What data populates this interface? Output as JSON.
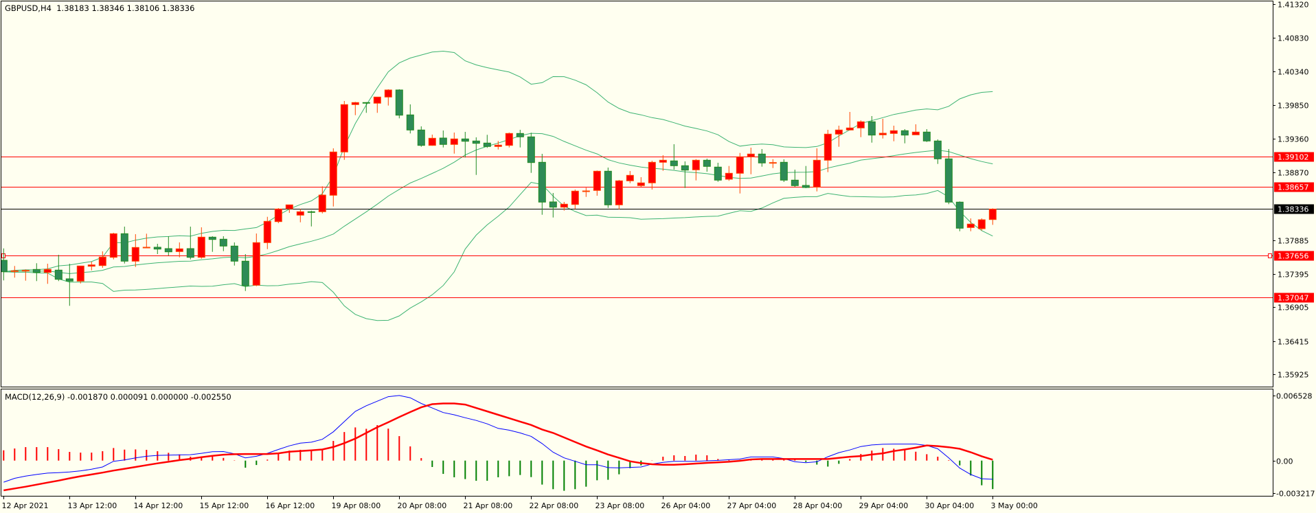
{
  "header": {
    "text": "GBPUSD,H4  1.38183 1.38346 1.38106 1.38336"
  },
  "macd_header": {
    "text": "MACD(12,26,9) -0.001870 0.000091 0.000000 -0.002550"
  },
  "colors": {
    "background": "#fffff0",
    "bull_body": "#ff0000",
    "bull_border": "#ff4500",
    "bear_body": "#2e8b57",
    "bear_border": "#228b22",
    "bands": "#3cb371",
    "macd_line": "#0000ff",
    "signal_line": "#ff0000",
    "hist_pos": "#ff0000",
    "hist_neg": "#008000"
  },
  "price_axis": [
    "1.41320",
    "1.40830",
    "1.40340",
    "1.39850",
    "1.39360",
    "1.38870",
    "1.37885",
    "1.37395",
    "1.36905",
    "1.36415",
    "1.35925"
  ],
  "macd_axis": [
    "0.006528",
    "0.00",
    "-0.003217"
  ],
  "time_axis": [
    "12 Apr 2021",
    "13 Apr 12:00",
    "14 Apr 12:00",
    "15 Apr 12:00",
    "16 Apr 12:00",
    "19 Apr 08:00",
    "20 Apr 08:00",
    "21 Apr 08:00",
    "22 Apr 08:00",
    "23 Apr 08:00",
    "26 Apr 04:00",
    "27 Apr 04:00",
    "28 Apr 04:00",
    "29 Apr 04:00",
    "30 Apr 04:00",
    "3 May 00:00"
  ],
  "levels": [
    {
      "label": "1.39102",
      "color": "#ff0000",
      "selected": false
    },
    {
      "label": "1.38657",
      "color": "#ff0000",
      "selected": false
    },
    {
      "label": "1.38336",
      "color": "#000000",
      "selected": false
    },
    {
      "label": "1.37656",
      "color": "#ff0000",
      "selected": true
    },
    {
      "label": "1.37047",
      "color": "#ff0000",
      "selected": false
    }
  ],
  "chart_data": {
    "type": "candlestick",
    "symbol": "GBPUSD",
    "timeframe": "H4",
    "ylim": [
      1.35925,
      1.4132
    ],
    "ohlc": [
      [
        1.3759,
        1.37763,
        1.37297,
        1.37423
      ],
      [
        1.37427,
        1.37507,
        1.37337,
        1.37437
      ],
      [
        1.37433,
        1.37457,
        1.37293,
        1.37443
      ],
      [
        1.37457,
        1.37547,
        1.37287,
        1.37413
      ],
      [
        1.37413,
        1.3754,
        1.37247,
        1.37457
      ],
      [
        1.37447,
        1.3767,
        1.37287,
        1.37313
      ],
      [
        1.3732,
        1.3754,
        1.36927,
        1.37287
      ],
      [
        1.37287,
        1.37507,
        1.37253,
        1.37507
      ],
      [
        1.37503,
        1.3757,
        1.37443,
        1.37523
      ],
      [
        1.37513,
        1.3772,
        1.3748,
        1.37637
      ],
      [
        1.37633,
        1.3799,
        1.37603,
        1.37977
      ],
      [
        1.37977,
        1.3808,
        1.37543,
        1.37577
      ],
      [
        1.37577,
        1.3797,
        1.37493,
        1.37777
      ],
      [
        1.3777,
        1.37977,
        1.3777,
        1.3778
      ],
      [
        1.3778,
        1.3783,
        1.3768,
        1.37753
      ],
      [
        1.3776,
        1.3794,
        1.3766,
        1.37713
      ],
      [
        1.37717,
        1.3785,
        1.37633,
        1.37757
      ],
      [
        1.3776,
        1.3808,
        1.37603,
        1.37633
      ],
      [
        1.37633,
        1.3807,
        1.37613,
        1.37927
      ],
      [
        1.37927,
        1.3794,
        1.37713,
        1.37893
      ],
      [
        1.37897,
        1.3794,
        1.37723,
        1.37797
      ],
      [
        1.37797,
        1.3785,
        1.37513,
        1.37577
      ],
      [
        1.37577,
        1.3768,
        1.37143,
        1.3722
      ],
      [
        1.37227,
        1.3798,
        1.37213,
        1.37847
      ],
      [
        1.37847,
        1.38223,
        1.37753,
        1.38157
      ],
      [
        1.38153,
        1.3835,
        1.3813,
        1.38337
      ],
      [
        1.3834,
        1.38397,
        1.3828,
        1.38397
      ],
      [
        1.38247,
        1.38337,
        1.38143,
        1.38297
      ],
      [
        1.38297,
        1.38313,
        1.38083,
        1.3829
      ],
      [
        1.38297,
        1.38667,
        1.38273,
        1.3854
      ],
      [
        1.38537,
        1.3922,
        1.38373,
        1.39167
      ],
      [
        1.39167,
        1.3991,
        1.39053,
        1.39857
      ],
      [
        1.39857,
        1.39897,
        1.39703,
        1.39887
      ],
      [
        1.39887,
        1.39893,
        1.39737,
        1.39877
      ],
      [
        1.39877,
        1.39967,
        1.39737,
        1.39967
      ],
      [
        1.39967,
        1.4008,
        1.39843,
        1.4007
      ],
      [
        1.4007,
        1.4008,
        1.39657,
        1.39703
      ],
      [
        1.39707,
        1.3986,
        1.39437,
        1.39487
      ],
      [
        1.39487,
        1.3954,
        1.39243,
        1.39263
      ],
      [
        1.39263,
        1.3942,
        1.39257,
        1.39367
      ],
      [
        1.3937,
        1.3948,
        1.39233,
        1.39277
      ],
      [
        1.39277,
        1.3945,
        1.39143,
        1.39357
      ],
      [
        1.39357,
        1.3946,
        1.39087,
        1.39323
      ],
      [
        1.39327,
        1.3938,
        1.38833,
        1.39293
      ],
      [
        1.39297,
        1.39417,
        1.39227,
        1.39247
      ],
      [
        1.39247,
        1.39327,
        1.39203,
        1.39267
      ],
      [
        1.39263,
        1.3945,
        1.39233,
        1.39437
      ],
      [
        1.39437,
        1.3949,
        1.39233,
        1.39387
      ],
      [
        1.39387,
        1.39447,
        1.38863,
        1.39013
      ],
      [
        1.39017,
        1.3914,
        1.38253,
        1.38437
      ],
      [
        1.3844,
        1.3857,
        1.38213,
        1.38363
      ],
      [
        1.38363,
        1.3844,
        1.38313,
        1.38407
      ],
      [
        1.38403,
        1.3862,
        1.38337,
        1.38597
      ],
      [
        1.38593,
        1.38647,
        1.38513,
        1.386
      ],
      [
        1.38607,
        1.38897,
        1.3853,
        1.38887
      ],
      [
        1.38887,
        1.3894,
        1.38353,
        1.38397
      ],
      [
        1.38397,
        1.3876,
        1.3833,
        1.38747
      ],
      [
        1.38747,
        1.3889,
        1.38713,
        1.38827
      ],
      [
        1.38677,
        1.388,
        1.3866,
        1.38717
      ],
      [
        1.38717,
        1.3904,
        1.3862,
        1.39017
      ],
      [
        1.39017,
        1.3912,
        1.38893,
        1.39047
      ],
      [
        1.39037,
        1.3928,
        1.3891,
        1.38967
      ],
      [
        1.38967,
        1.3903,
        1.38643,
        1.38903
      ],
      [
        1.38907,
        1.39063,
        1.38753,
        1.39047
      ],
      [
        1.39047,
        1.3907,
        1.3888,
        1.38957
      ],
      [
        1.38947,
        1.3901,
        1.38733,
        1.38757
      ],
      [
        1.3877,
        1.38963,
        1.38747,
        1.38857
      ],
      [
        1.38857,
        1.39153,
        1.38563,
        1.39097
      ],
      [
        1.39097,
        1.3923,
        1.38843,
        1.39137
      ],
      [
        1.39137,
        1.3921,
        1.38953,
        1.39007
      ],
      [
        1.39007,
        1.39063,
        1.38933,
        1.39013
      ],
      [
        1.39017,
        1.3906,
        1.3873,
        1.38757
      ],
      [
        1.38757,
        1.3891,
        1.3866,
        1.38677
      ],
      [
        1.3868,
        1.38963,
        1.3864,
        1.3865
      ],
      [
        1.38657,
        1.3922,
        1.38593,
        1.39047
      ],
      [
        1.39047,
        1.3949,
        1.38873,
        1.39427
      ],
      [
        1.39427,
        1.3955,
        1.39243,
        1.39487
      ],
      [
        1.39487,
        1.3975,
        1.3948,
        1.39517
      ],
      [
        1.39517,
        1.39627,
        1.39383,
        1.39607
      ],
      [
        1.39607,
        1.3969,
        1.39303,
        1.39413
      ],
      [
        1.39417,
        1.3965,
        1.39363,
        1.3944
      ],
      [
        1.39437,
        1.3955,
        1.39323,
        1.39477
      ],
      [
        1.39477,
        1.395,
        1.39293,
        1.39413
      ],
      [
        1.39417,
        1.3957,
        1.39417,
        1.39457
      ],
      [
        1.39457,
        1.395,
        1.39313,
        1.39327
      ],
      [
        1.39327,
        1.3935,
        1.38993,
        1.39067
      ],
      [
        1.39067,
        1.3921,
        1.38407,
        1.38437
      ],
      [
        1.38437,
        1.38447,
        1.38013,
        1.38057
      ],
      [
        1.38067,
        1.382,
        1.38013,
        1.38117
      ],
      [
        1.3805,
        1.382,
        1.38023,
        1.3818
      ],
      [
        1.38183,
        1.38346,
        1.38106,
        1.38336
      ]
    ],
    "macd": {
      "ylim": [
        -0.003217,
        0.006528
      ],
      "main": [
        -0.002157,
        -0.001771,
        -0.001544,
        -0.001385,
        -0.001249,
        -0.001203,
        -0.001135,
        -0.001022,
        -0.000863,
        -0.000636,
        -6.8e-05,
        6.8e-05,
        0.000272,
        0.000431,
        0.000522,
        0.000545,
        0.000568,
        0.00059,
        0.000726,
        0.000885,
        0.000908,
        0.000681,
        0.000272,
        0.000431,
        0.000726,
        0.001112,
        0.001476,
        0.001748,
        0.001839,
        0.002134,
        0.002883,
        0.003904,
        0.004926,
        0.005493,
        0.005947,
        0.006401,
        0.006515,
        0.006288,
        0.00572,
        0.005266,
        0.004812,
        0.004585,
        0.00429,
        0.004018,
        0.003677,
        0.003223,
        0.003042,
        0.002769,
        0.002429,
        0.001703,
        0.00084,
        0.000272,
        -6.8e-05,
        -0.000409,
        -0.000409,
        -0.000704,
        -0.000726,
        -0.000681,
        -0.000636,
        -0.000341,
        -0.000182,
        -6.8e-05,
        -6.8e-05,
        -6.8e-05,
        -2.3e-05,
        2.3e-05,
        9.1e-05,
        0.000159,
        0.000363,
        0.000363,
        0.000363,
        0.000204,
        -0.000114,
        -0.000204,
        -0.000114,
        0.000386,
        0.000795,
        0.001067,
        0.001407,
        0.001566,
        0.001634,
        0.001657,
        0.001657,
        0.001657,
        0.001521,
        0.00118,
        0.000272,
        -0.000749,
        -0.001385,
        -0.001816,
        -0.00187
      ],
      "signal": [
        -0.002974,
        -0.002792,
        -0.002611,
        -0.002406,
        -0.002202,
        -0.001998,
        -0.001771,
        -0.001566,
        -0.001385,
        -0.001203,
        -0.000999,
        -0.000817,
        -0.000636,
        -0.000454,
        -0.000272,
        -0.000114,
        4.5e-05,
        0.000182,
        0.000341,
        0.000477,
        0.00059,
        0.000636,
        0.000658,
        0.000658,
        0.000658,
        0.000726,
        0.000885,
        0.000953,
        0.001022,
        0.001112,
        0.001362,
        0.001748,
        0.002202,
        0.002769,
        0.003337,
        0.003836,
        0.004358,
        0.004858,
        0.005335,
        0.005652,
        0.00572,
        0.00572,
        0.005607,
        0.005266,
        0.004926,
        0.004585,
        0.004245,
        0.003904,
        0.003564,
        0.00311,
        0.002769,
        0.002315,
        0.001861,
        0.001407,
        0.001022,
        0.000613,
        0.000272,
        -6.8e-05,
        -0.00025,
        -0.000363,
        -0.000409,
        -0.000409,
        -0.000363,
        -0.000295,
        -0.000227,
        -0.000182,
        -0.000114,
        -2.3e-05,
        0.000114,
        0.000159,
        0.000159,
        0.000159,
        0.000159,
        0.000159,
        0.000159,
        0.000159,
        0.000272,
        0.000386,
        0.000454,
        0.000613,
        0.000726,
        0.000953,
        0.001112,
        0.001294,
        0.001521,
        0.001453,
        0.001339,
        0.00118,
        0.00084,
        0.000431,
        9.1e-05
      ],
      "histogram": [
        0.00103,
        0.00121,
        0.00135,
        0.00135,
        0.00135,
        0.00115,
        0.00087,
        0.0008,
        0.0008,
        0.00094,
        0.00126,
        0.0011,
        0.00112,
        0.00108,
        0.00094,
        0.00078,
        0.00062,
        0.00039,
        0.00039,
        0.00039,
        0.00027,
        3e-05,
        -0.00071,
        -0.00044,
        0.0001,
        0.00069,
        0.001,
        0.00108,
        0.00108,
        0.00115,
        0.00197,
        0.00286,
        0.00332,
        0.00318,
        0.00355,
        0.0032,
        0.00245,
        0.00142,
        0.00025,
        -0.00064,
        -0.00133,
        -0.00167,
        -0.00185,
        -0.00202,
        -0.00202,
        -0.00167,
        -0.00156,
        -0.00144,
        -0.00165,
        -0.0024,
        -0.00286,
        -0.00302,
        -0.00286,
        -0.00261,
        -0.00197,
        -0.00192,
        -0.00137,
        -0.00076,
        -0.00048,
        2e-05,
        0.00039,
        0.00053,
        0.00046,
        0.0006,
        0.00053,
        0.00016,
        0.00011,
        7e-05,
        9e-05,
        0.00011,
        0.00011,
        0.00016,
        0.00011,
        -0.00014,
        -0.0004,
        -0.0006,
        -0.00032,
        0.00016,
        0.00066,
        0.001,
        0.00126,
        0.00119,
        0.00112,
        0.00089,
        0.00064,
        0.00039,
        5e-05,
        -0.00048,
        -0.00149,
        -0.00247,
        -0.00285
      ]
    }
  }
}
